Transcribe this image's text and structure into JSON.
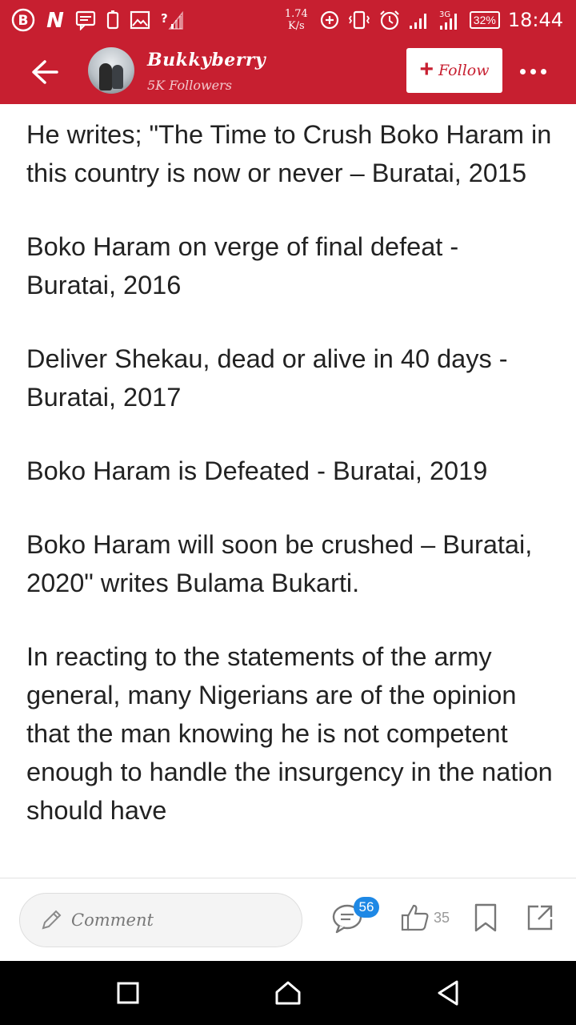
{
  "status_bar": {
    "network_speed_value": "1.74",
    "network_speed_unit": "K/s",
    "battery": "32%",
    "time": "18:44",
    "left_icons": [
      "b-app-icon",
      "n-app-icon",
      "message-icon",
      "phone-outline-icon",
      "image-icon",
      "no-signal-icon"
    ],
    "right_icons": [
      "plus-circle-icon",
      "vibrate-icon",
      "alarm-icon",
      "signal-icon",
      "3g-signal-icon"
    ],
    "tiny_label_3g": "3G"
  },
  "header": {
    "channel_name": "Bukkyberry",
    "followers": "5K Followers",
    "follow_label": "Follow",
    "follow_plus": "+"
  },
  "article": {
    "paragraphs": [
      "He writes; \"The Time to Crush Boko Haram in this country is now or never – Buratai, 2015",
      "Boko Haram on verge of final defeat - Buratai, 2016",
      "Deliver Shekau, dead or alive in 40 days - Buratai, 2017",
      "Boko Haram is Defeated - Buratai, 2019",
      "Boko Haram will soon be crushed – Buratai, 2020\" writes Bulama Bukarti.",
      "In reacting to the statements of the army general, many Nigerians are of the opinion that the man knowing he is not competent enough to handle the insurgency in the nation should have"
    ]
  },
  "action_bar": {
    "comment_placeholder": "Comment",
    "comment_count": "56",
    "like_count": "35"
  },
  "colors": {
    "brand_red": "#c71f30",
    "badge_blue": "#1e88e5"
  }
}
